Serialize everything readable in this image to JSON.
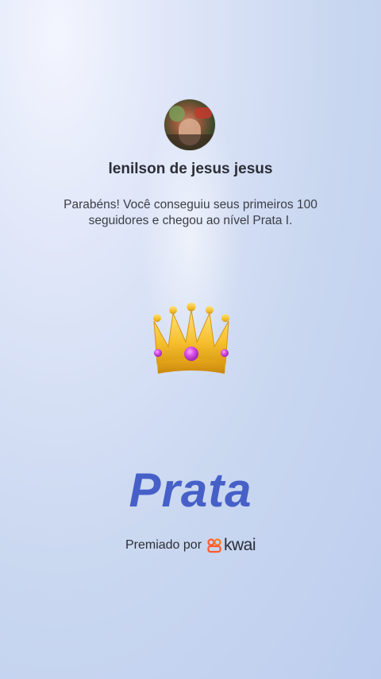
{
  "profile": {
    "username": "lenilson de jesus jesus"
  },
  "congrats": {
    "message": "Parabéns! Você conseguiu seus primeiros 100 seguidores e chegou ao nível Prata I."
  },
  "badge": {
    "icon": "crown-icon",
    "level_name": "Prata"
  },
  "footer": {
    "awarded_by_label": "Premiado por",
    "brand_icon": "kwai-logo-icon",
    "brand_name": "kwai"
  },
  "colors": {
    "level_text": "#4660c8",
    "brand_accent": "#ff5a2e"
  }
}
